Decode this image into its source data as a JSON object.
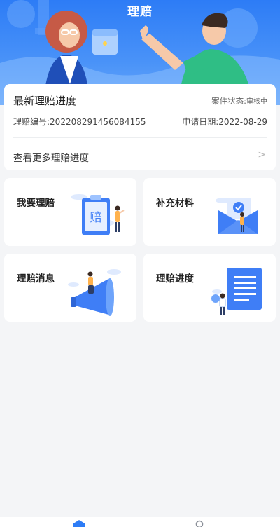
{
  "header": {
    "title": "理赔"
  },
  "progress": {
    "title": "最新理赔进度",
    "status_label": "案件状态:",
    "status_value": "审核中",
    "claim_no": "理赔编号:202208291456084155",
    "apply_date": "申请日期:2022-08-29",
    "more": "查看更多理赔进度",
    "chevron": ">"
  },
  "tiles": [
    {
      "label": "我要理赔",
      "icon": "claim-document-illustration"
    },
    {
      "label": "补充材料",
      "icon": "envelope-illustration"
    },
    {
      "label": "理赔消息",
      "icon": "megaphone-illustration"
    },
    {
      "label": "理赔进度",
      "icon": "progress-document-illustration"
    }
  ],
  "tabbar": {
    "icons": [
      "home-tab-icon",
      "profile-tab-icon"
    ]
  },
  "colors": {
    "primary": "#2d7cf6",
    "background": "#f4f5f7",
    "card": "#ffffff"
  }
}
